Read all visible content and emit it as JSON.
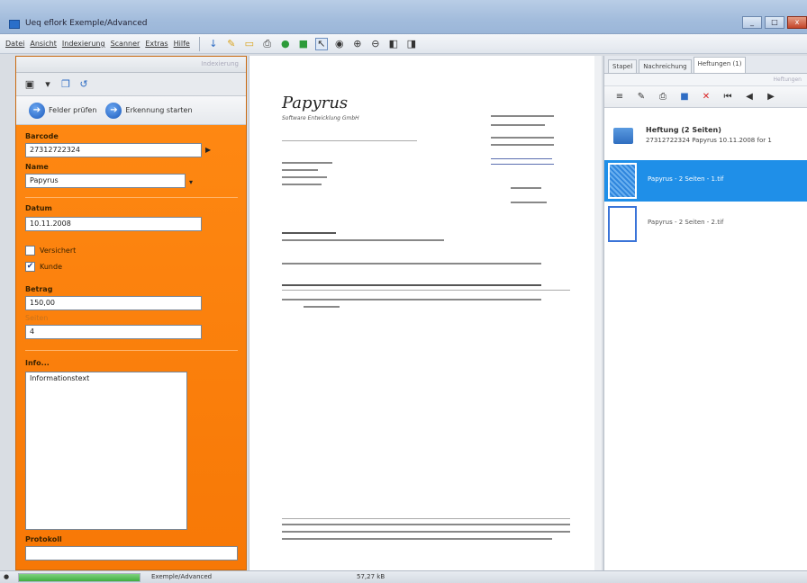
{
  "window": {
    "title": "Ueq eflork Exemple/Advanced",
    "btn_min": "_",
    "btn_max": "□",
    "btn_close": "x"
  },
  "menu": [
    "Datei",
    "Ansicht",
    "Indexierung",
    "Scanner",
    "Extras",
    "Hilfe"
  ],
  "left_panel": {
    "header": "Indexierung",
    "actions": {
      "check_fields": "Felder prüfen",
      "start_recognition": "Erkennung starten"
    },
    "barcode": {
      "label": "Barcode",
      "value": "27312722324"
    },
    "name": {
      "label": "Name",
      "value": "Papyrus"
    },
    "datum": {
      "label": "Datum",
      "value": "10.11.2008"
    },
    "versichert": {
      "label": "Versichert",
      "checked": false
    },
    "kunde": {
      "label": "Kunde",
      "checked": true
    },
    "betrag": {
      "label": "Betrag",
      "value": "150,00"
    },
    "field4": {
      "label": "Seiten",
      "value": "4"
    },
    "info": {
      "label": "Info...",
      "value": "Informationstext"
    },
    "protokoll": {
      "label": "Protokoll",
      "value": ""
    }
  },
  "document": {
    "brand": "Papyrus",
    "subtitle": "Software Entwicklung GmbH"
  },
  "right_panel": {
    "tabs": [
      "Stapel",
      "Nachreichung",
      "Heftungen (1)"
    ],
    "active_tab": 2,
    "sub_header": "Heftungen",
    "group": {
      "title": "Heftung (2 Seiten)",
      "subtitle": "27312722324 Papyrus 10.11.2008 for 1"
    },
    "items": [
      {
        "label": "Papyrus - 2 Seiten - 1.tif",
        "selected": true
      },
      {
        "label": "Papyrus - 2 Seiten - 2.tif",
        "selected": false
      }
    ]
  },
  "status": {
    "profile": "Exemple/Advanced",
    "size": "57,27 kB",
    "progress": 1.0
  }
}
